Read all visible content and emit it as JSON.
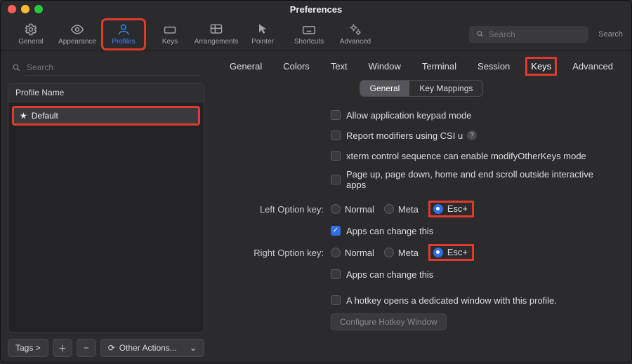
{
  "window": {
    "title": "Preferences"
  },
  "toolbar": {
    "items": [
      {
        "label": "General"
      },
      {
        "label": "Appearance"
      },
      {
        "label": "Profiles"
      },
      {
        "label": "Keys"
      },
      {
        "label": "Arrangements"
      },
      {
        "label": "Pointer"
      },
      {
        "label": "Shortcuts"
      },
      {
        "label": "Advanced"
      }
    ],
    "search_placeholder": "Search",
    "search_label": "Search"
  },
  "sidebar": {
    "search_placeholder": "Search",
    "header": "Profile Name",
    "profiles": [
      {
        "name": "Default",
        "starred": true
      }
    ],
    "tags_label": "Tags >",
    "other_actions": "Other Actions..."
  },
  "tabs_outer": [
    "General",
    "Colors",
    "Text",
    "Window",
    "Terminal",
    "Session",
    "Keys",
    "Advanced"
  ],
  "active_outer": "Keys",
  "tabs_inner": [
    "General",
    "Key Mappings"
  ],
  "active_inner": "General",
  "form": {
    "chk1": "Allow application keypad mode",
    "chk2": "Report modifiers using CSI u",
    "chk3": "xterm control sequence can enable modifyOtherKeys mode",
    "chk4": "Page up, page down, home and end scroll outside interactive apps",
    "left_label": "Left Option key:",
    "right_label": "Right Option key:",
    "opt_normal": "Normal",
    "opt_meta": "Meta",
    "opt_esc": "Esc+",
    "left_apps": "Apps can change this",
    "right_apps": "Apps can change this",
    "hotkey": "A hotkey opens a dedicated window with this profile.",
    "cfg": "Configure Hotkey Window"
  },
  "icons": {
    "gear": "gear",
    "eye": "eye",
    "profile": "profile",
    "keys": "keys",
    "grid": "grid",
    "pointer": "pointer",
    "kbd": "kbd",
    "adv": "adv",
    "search": "search",
    "star": "star",
    "plus": "+",
    "minus": "−",
    "loop": "loop",
    "chev": "⌄"
  }
}
